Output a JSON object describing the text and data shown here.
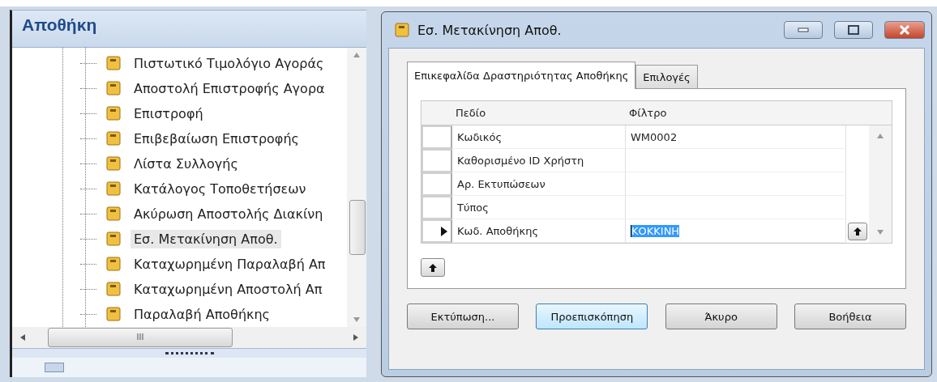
{
  "navigation": {
    "title": "Αποθήκη",
    "items": [
      {
        "label": "Πιστωτικό Τιμολόγιο Αγοράς",
        "selected": false
      },
      {
        "label": "Αποστολή Επιστροφής Αγορα",
        "selected": false
      },
      {
        "label": "Επιστροφή",
        "selected": false
      },
      {
        "label": "Επιβεβαίωση Επιστροφής",
        "selected": false
      },
      {
        "label": "Λίστα Συλλογής",
        "selected": false
      },
      {
        "label": "Κατάλογος Τοποθετήσεων",
        "selected": false
      },
      {
        "label": "Ακύρωση Αποστολής Διακίνη",
        "selected": false
      },
      {
        "label": "Εσ. Μετακίνηση Αποθ.",
        "selected": true
      },
      {
        "label": "Καταχωρημένη Παραλαβή Απ",
        "selected": false
      },
      {
        "label": "Καταχωρημένη Αποστολή Απ",
        "selected": false
      },
      {
        "label": "Παραλαβή Αποθήκης",
        "selected": false
      }
    ],
    "scrollbar_grip": "III"
  },
  "dialog": {
    "title": "Εσ. Μετακίνηση Αποθ.",
    "tabs": [
      {
        "label": "Επικεφαλίδα Δραστηριότητας Αποθήκης",
        "selected": true
      },
      {
        "label": "Επιλογές",
        "selected": false
      }
    ],
    "grid": {
      "columns": [
        "Πεδίο",
        "Φίλτρο"
      ],
      "rows": [
        {
          "field": "Κωδικός",
          "filter": "WM0002",
          "current": false
        },
        {
          "field": "Καθορισμένο ID Χρήστη",
          "filter": "",
          "current": false
        },
        {
          "field": "Αρ. Εκτυπώσεων",
          "filter": "",
          "current": false
        },
        {
          "field": "Τύπος",
          "filter": "",
          "current": false
        },
        {
          "field": "Κωδ. Αποθήκης",
          "filter": "ΚΟΚΚΙΝΗ",
          "current": true
        }
      ]
    },
    "buttons": [
      {
        "label": "Εκτύπωση...",
        "focused": false
      },
      {
        "label": "Προεπισκόπηση",
        "focused": true
      },
      {
        "label": "Άκυρο",
        "focused": false
      },
      {
        "label": "Βοήθεια",
        "focused": false
      }
    ]
  }
}
